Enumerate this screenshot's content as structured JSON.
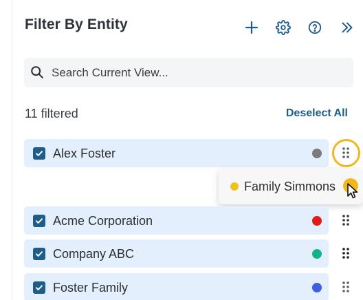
{
  "header": {
    "title": "Filter By Entity",
    "icons": [
      "plus-icon",
      "gear-icon",
      "help-icon",
      "double-chevron-right-icon"
    ],
    "accent_color": "#1c5d8a"
  },
  "search": {
    "placeholder": "Search Current View..."
  },
  "summary": {
    "filtered_count": "11 filtered",
    "deselect_label": "Deselect All"
  },
  "entities": [
    {
      "label": "Alex Foster",
      "checked": true,
      "color": "#7a7a7a"
    },
    {
      "label": "Acme Corporation",
      "checked": true,
      "color": "#e01b1b"
    },
    {
      "label": "Company ABC",
      "checked": true,
      "color": "#12b389"
    },
    {
      "label": "Foster Family",
      "checked": true,
      "color": "#3e5fe0"
    }
  ],
  "dragging": {
    "label": "Family Simmons",
    "color": "#eec21a",
    "highlight_color": "#f0b81d"
  }
}
